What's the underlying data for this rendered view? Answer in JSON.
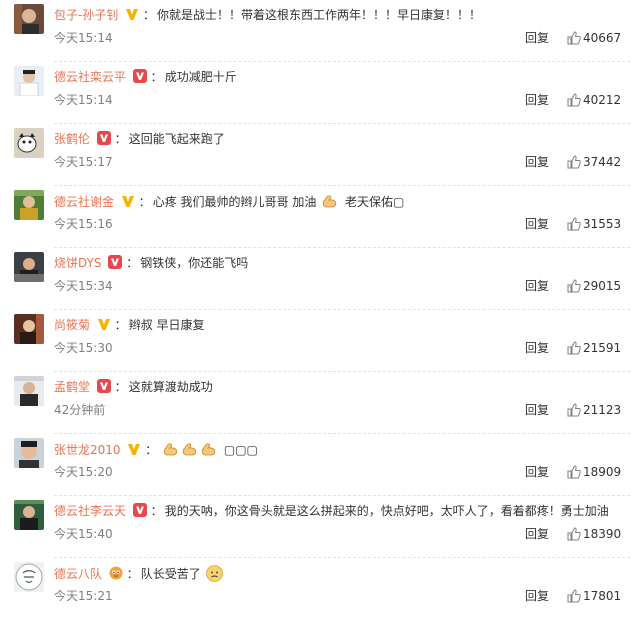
{
  "colors": {
    "username": "#eb7350",
    "text": "#333333",
    "time": "#808080",
    "badge_red": "#e8484b",
    "badge_gold": "#f5b400"
  },
  "comments": [
    {
      "username": "包子-孙子钊",
      "badge": "gold",
      "colon": "：",
      "text": "你就是战士！！带着这根东西工作两年！！！早日康复！！！",
      "time": "今天15:14",
      "reply": "回复",
      "likes": "40667"
    },
    {
      "username": "德云社栾云平",
      "badge": "red",
      "colon": "：",
      "text": "成功减肥十斤",
      "time": "今天15:14",
      "reply": "回复",
      "likes": "40212"
    },
    {
      "username": "张鹤伦",
      "badge": "red",
      "colon": "：",
      "text": "这回能飞起来跑了",
      "time": "今天15:17",
      "reply": "回复",
      "likes": "37442"
    },
    {
      "username": "德云社谢金",
      "badge": "gold",
      "colon": "：",
      "text_a": "心疼 我们最帅的辫儿哥哥 加油",
      "emoji_a": "muscle-emoji",
      "text_b": "老天保佑▢",
      "time": "今天15:16",
      "reply": "回复",
      "likes": "31553"
    },
    {
      "username": "烧饼DYS",
      "badge": "red",
      "colon": "：",
      "text": "钢铁侠，你还能飞吗",
      "time": "今天15:34",
      "reply": "回复",
      "likes": "29015"
    },
    {
      "username": "尚筱菊",
      "badge": "gold",
      "colon": "：",
      "text": "辫叔 早日康复",
      "time": "今天15:30",
      "reply": "回复",
      "likes": "21591"
    },
    {
      "username": "孟鹤堂",
      "badge": "red",
      "colon": "：",
      "text": "这就算渡劫成功",
      "time": "42分钟前",
      "reply": "回复",
      "likes": "21123"
    },
    {
      "username": "张世龙2010",
      "badge": "gold",
      "colon": "：",
      "emojis": [
        "muscle-emoji",
        "muscle-emoji",
        "muscle-emoji"
      ],
      "text": "▢▢▢",
      "time": "今天15:20",
      "reply": "回复",
      "likes": "18909"
    },
    {
      "username": "德云社李云天",
      "badge": "red",
      "colon": "：",
      "text": "我的天呐，你这骨头就是这么拼起来的，快点好吧，太吓人了，看着都疼！勇士加油",
      "time": "今天15:40",
      "reply": "回复",
      "likes": "18390"
    },
    {
      "username": "德云八队",
      "badge": "fan",
      "colon": "：",
      "text": "队长受苦了",
      "emoji_end": "worried-face-emoji",
      "time": "今天15:21",
      "reply": "回复",
      "likes": "17801"
    }
  ]
}
